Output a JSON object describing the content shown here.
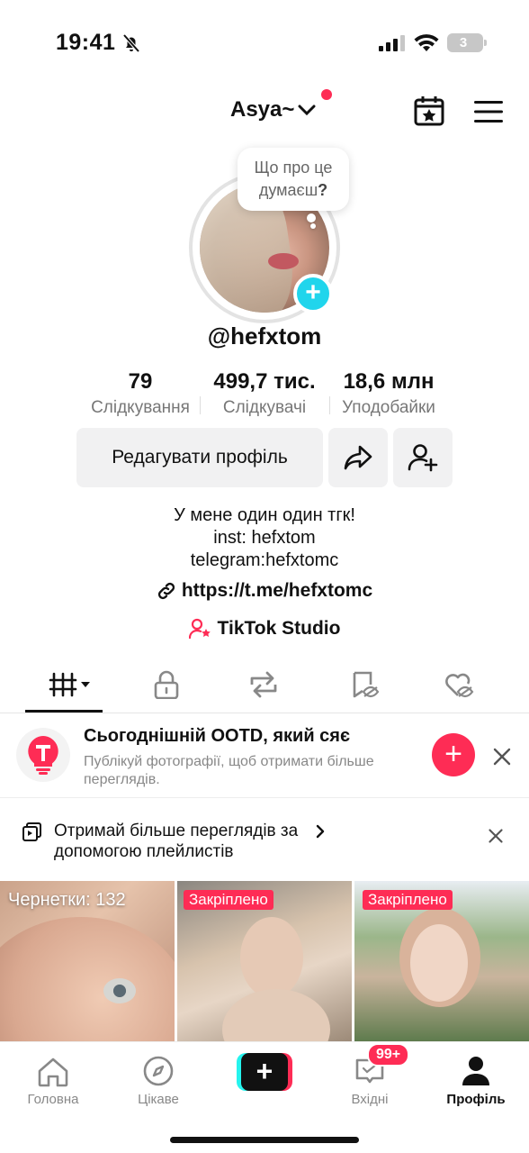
{
  "status_bar": {
    "time": "19:41",
    "battery": "3"
  },
  "header": {
    "account_name": "Asya~"
  },
  "bubble": {
    "line1": "Що про це",
    "line2": "думаєш",
    "q": "?"
  },
  "profile": {
    "username": "@hefxtom"
  },
  "stats": [
    {
      "value": "79",
      "label": "Слідкування"
    },
    {
      "value": "499,7 тис.",
      "label": "Слідкувачі"
    },
    {
      "value": "18,6 млн",
      "label": "Уподобайки"
    }
  ],
  "actions": {
    "edit_label": "Редагувати профіль"
  },
  "bio": {
    "lines": [
      "У мене один один тгк!",
      "inst: hefxtom",
      "telegram:hefxtomc"
    ],
    "link": "https://t.me/hefxtomc",
    "studio": "TikTok Studio"
  },
  "promo": {
    "title": "Сьогоднішній OOTD, який сяє",
    "subtitle": "Публікуй фотографії, щоб отримати більше переглядів."
  },
  "playlist": {
    "text": "Отримай більше переглядів за допомогою плейлистів"
  },
  "grid": {
    "drafts_label": "Чернетки: 132",
    "pinned_label": "Закріплено"
  },
  "nav": {
    "home": "Головна",
    "discover": "Цікаве",
    "inbox": "Вхідні",
    "inbox_badge": "99+",
    "profile": "Профіль"
  },
  "colors": {
    "accent": "#fe2c55",
    "cyan": "#25f4ee",
    "badge_cyan": "#20d5ec"
  }
}
